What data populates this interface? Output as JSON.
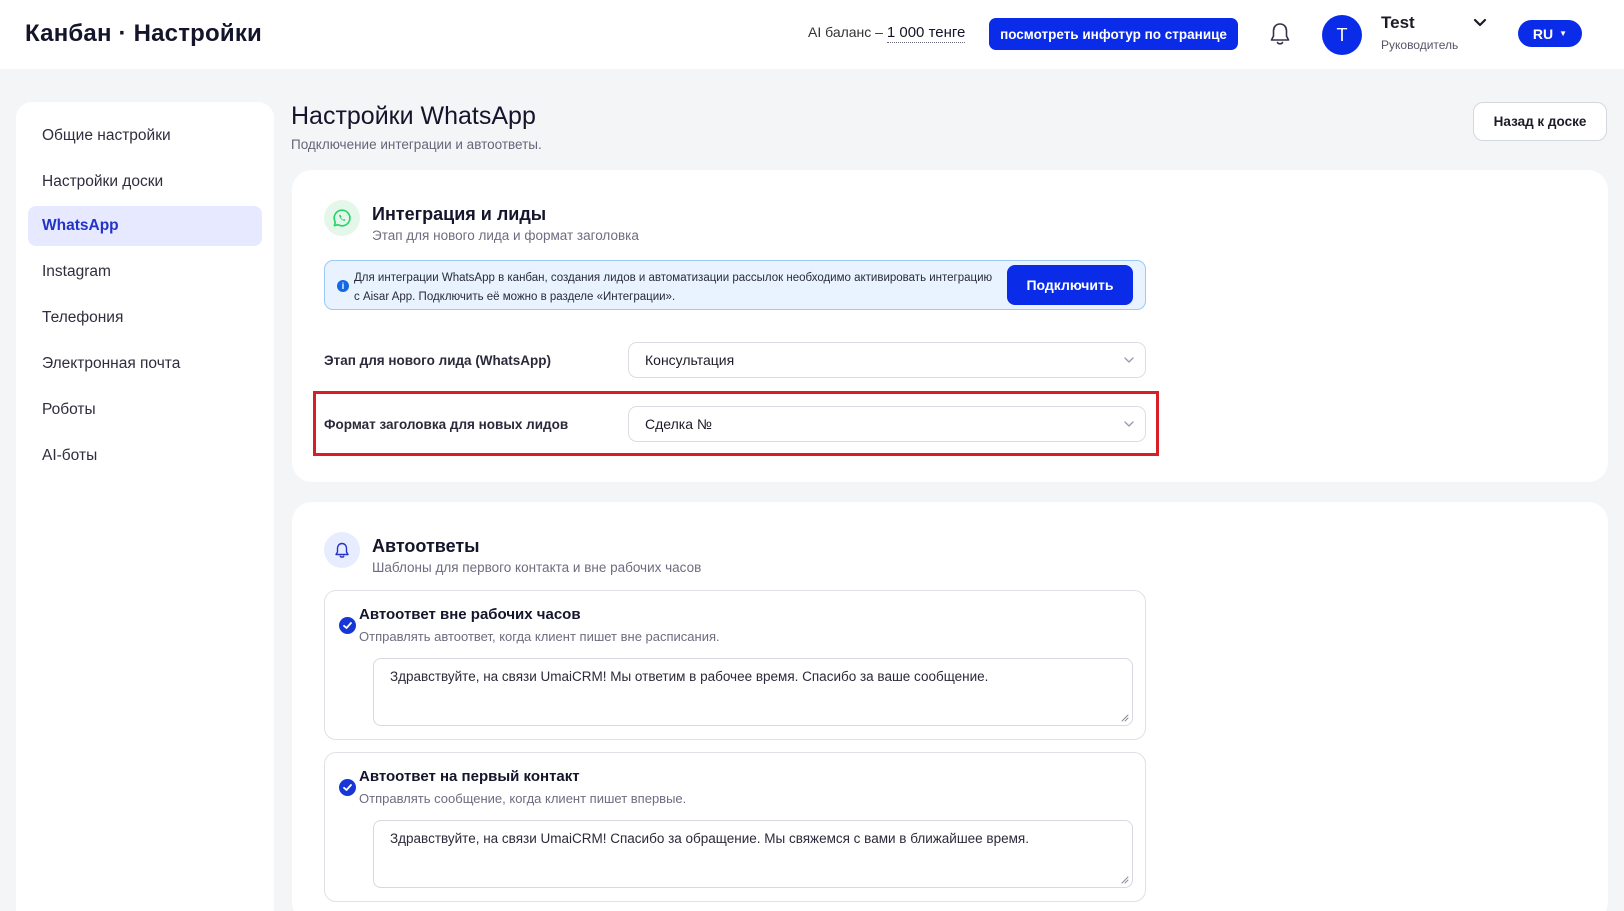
{
  "header": {
    "title": "Канбан · Настройки",
    "balance_label": "AI баланс –",
    "balance_value": "1 000 тенге",
    "infotour_label": "посмотреть инфотур по странице",
    "user": {
      "initial": "T",
      "name": "Test",
      "role": "Руководитель"
    },
    "language": "RU"
  },
  "sidebar": {
    "items": [
      {
        "label": "Общие настройки",
        "active": false
      },
      {
        "label": "Настройки доски",
        "active": false
      },
      {
        "label": "WhatsApp",
        "active": true
      },
      {
        "label": "Instagram",
        "active": false
      },
      {
        "label": "Телефония",
        "active": false
      },
      {
        "label": "Электронная почта",
        "active": false
      },
      {
        "label": "Роботы",
        "active": false
      },
      {
        "label": "AI-боты",
        "active": false
      }
    ]
  },
  "page": {
    "title": "Настройки WhatsApp",
    "subtitle": "Подключение интеграции и автоответы.",
    "back_label": "Назад к доске"
  },
  "integration": {
    "title": "Интеграция и лиды",
    "subtitle": "Этап для нового лида и формат заголовка",
    "info_text": "Для интеграции WhatsApp в канбан, создания лидов и автоматизации рассылок необходимо активировать интеграцию с Aisar App. Подключить её можно в разделе «Интеграции».",
    "connect_label": "Подключить",
    "stage_label": "Этап для нового лида (WhatsApp)",
    "stage_value": "Консультация",
    "format_label": "Формат заголовка для новых лидов",
    "format_value": "Сделка №"
  },
  "autoreplies": {
    "title": "Автоответы",
    "subtitle": "Шаблоны для первого контакта и вне рабочих часов",
    "items": [
      {
        "title": "Автоответ вне рабочих часов",
        "description": "Отправлять автоответ, когда клиент пишет вне расписания.",
        "checked": true,
        "message": "Здравствуйте, на связи UmaiCRM! Мы ответим в рабочее время. Спасибо за ваше сообщение."
      },
      {
        "title": "Автоответ на первый контакт",
        "description": "Отправлять сообщение, когда клиент пишет впервые.",
        "checked": true,
        "message": "Здравствуйте, на связи UmaiCRM! Спасибо за обращение. Мы свяжемся с вами в ближайшее время."
      }
    ]
  },
  "colors": {
    "accent": "#0a2ce8",
    "active_bg": "#e6e9ff",
    "highlight": "#d91f26",
    "whatsapp": "#25d366"
  }
}
